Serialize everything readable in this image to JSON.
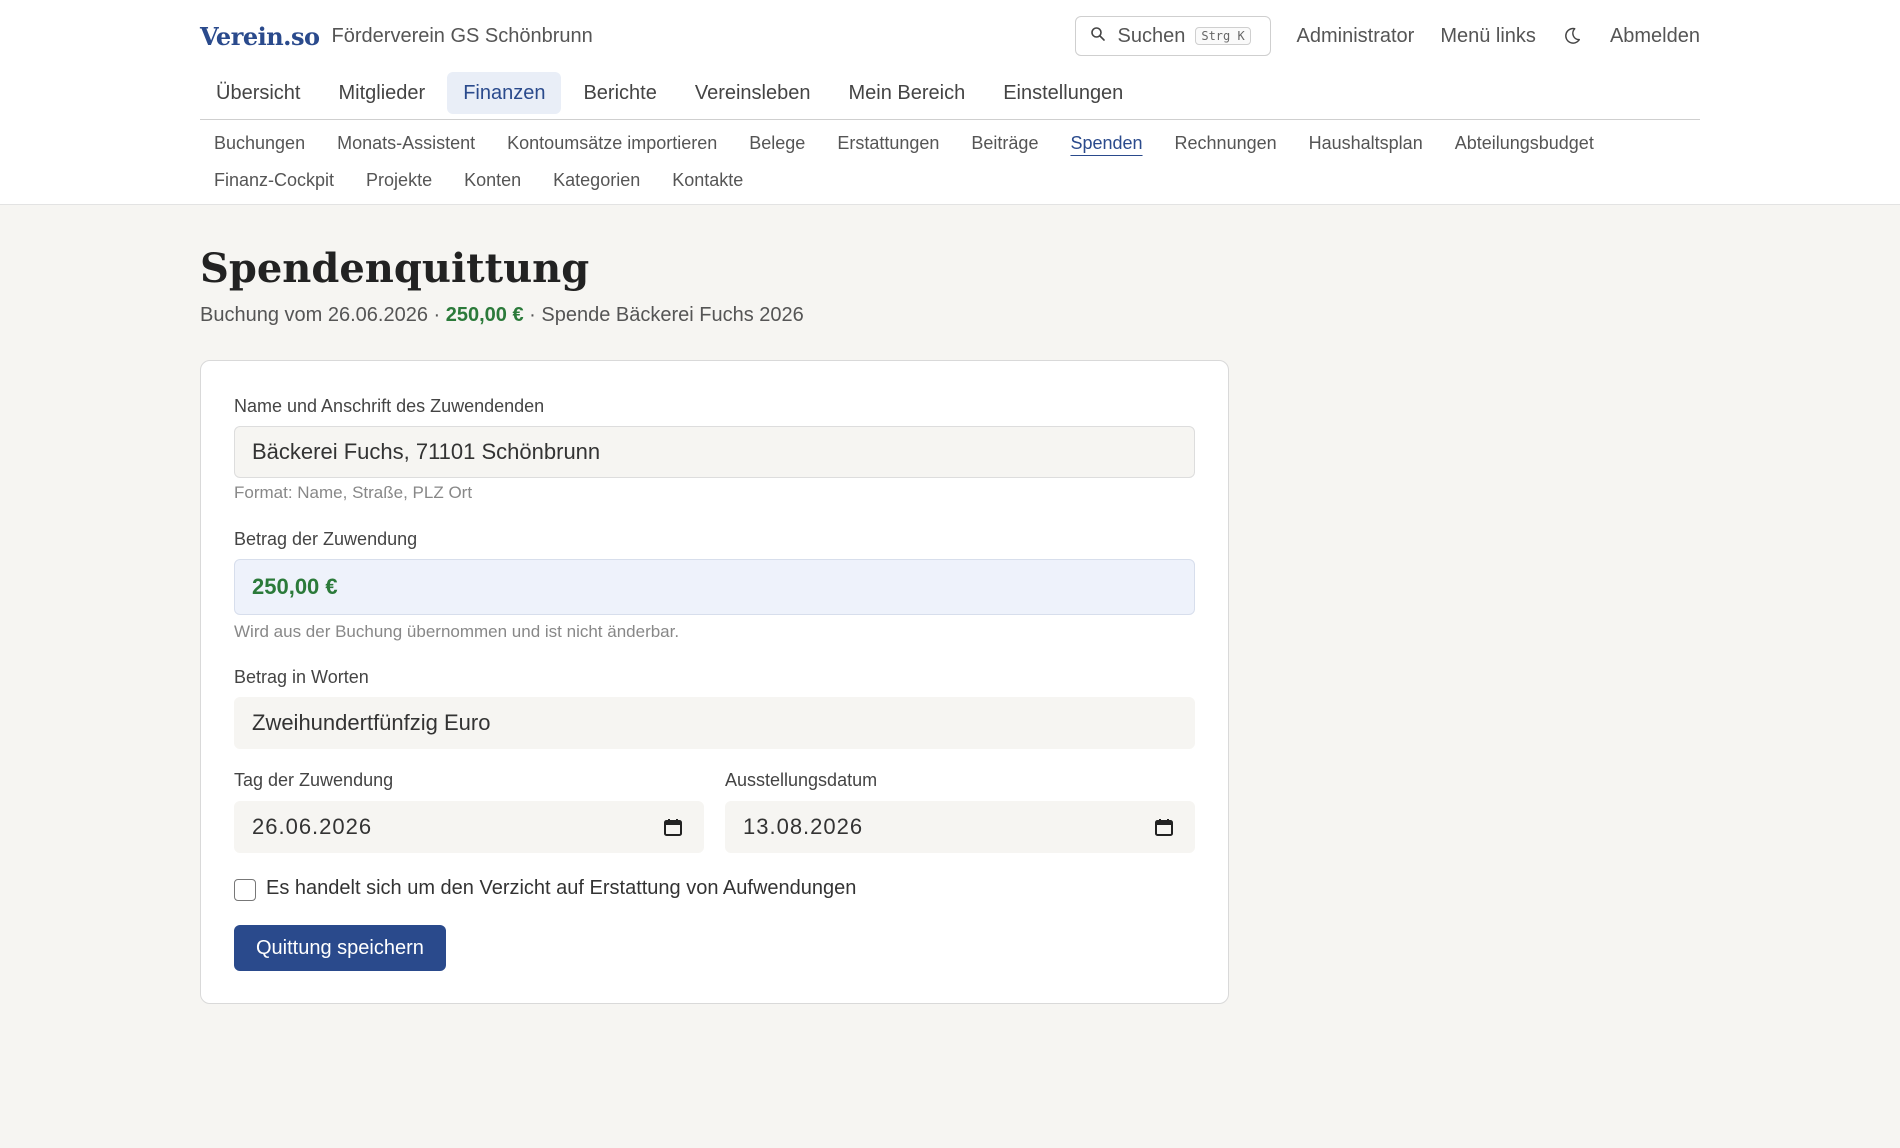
{
  "brand": {
    "logo": "Verein.so",
    "org": "Förderverein GS Schönbrunn"
  },
  "topbar": {
    "search_label": "Suchen",
    "search_shortcut": "Strg K",
    "links": [
      "Administrator",
      "Menü links",
      "Abmelden"
    ]
  },
  "mainnav": [
    "Übersicht",
    "Mitglieder",
    "Finanzen",
    "Berichte",
    "Vereinsleben",
    "Mein Bereich",
    "Einstellungen"
  ],
  "mainnav_active": "Finanzen",
  "subnav": {
    "row1": [
      "Buchungen",
      "Monats-Assistent",
      "Kontoumsätze importieren",
      "Belege",
      "Erstattungen",
      "Beiträge",
      "Spenden",
      "Rechnungen",
      "Haushaltsplan",
      "Abteilungsbudget"
    ],
    "row2": [
      "Finanz-Cockpit",
      "Projekte",
      "Konten",
      "Kategorien",
      "Kontakte"
    ],
    "active": "Spenden"
  },
  "page": {
    "title": "Spendenquittung",
    "subtitle_prefix": "Buchung vom 26.06.2026 ·",
    "subtitle_amount": "250,00 €",
    "subtitle_suffix": "· Spende Bäckerei Fuchs 2026"
  },
  "form": {
    "name_label": "Name und Anschrift des Zuwendenden",
    "name_value": "Bäckerei Fuchs, 71101 Schönbrunn",
    "name_hint": "Format: Name, Straße, PLZ Ort",
    "amount_label": "Betrag der Zuwendung",
    "amount_value": "250,00 €",
    "amount_hint": "Wird aus der Buchung übernommen und ist nicht änderbar.",
    "words_label": "Betrag in Worten",
    "words_value": "Zweihundertfünfzig Euro",
    "date_label": "Tag der Zuwendung",
    "date_value": "26.06.2026",
    "issue_label": "Ausstellungsdatum",
    "issue_value": "13.08.2026",
    "waiver_label": "Es handelt sich um den Verzicht auf Erstattung von Aufwendungen",
    "waiver_checked": false,
    "save_label": "Quittung speichern"
  },
  "colors": {
    "accent": "#2a4a8c",
    "amount_green": "#2b7a3a",
    "background": "#f6f5f2"
  },
  "icons": {
    "search": "search-icon",
    "theme": "moon-icon",
    "calendar": "calendar-icon"
  }
}
